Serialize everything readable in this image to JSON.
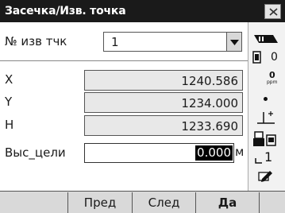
{
  "window": {
    "title": "Засечка/Изв. точка"
  },
  "form": {
    "point_label": "№ изв тчк",
    "point_value": "1",
    "x_label": "X",
    "x_value": "1240.586",
    "y_label": "Y",
    "y_value": "1234.000",
    "h_label": "H",
    "h_value": "1233.690",
    "target_label": "Выс_цели",
    "target_value": "0.000",
    "target_unit": "м"
  },
  "status": {
    "ppm_value": "0",
    "ppm_unit": "ppm",
    "prism_const": "0",
    "line_label": "1"
  },
  "softkeys": [
    "",
    "Пред",
    "След",
    "Да"
  ],
  "colors": {
    "titlebar": "#1a1a1a",
    "softkey_bg": "#d9d9d9",
    "field_bg": "#e8e8e8"
  }
}
